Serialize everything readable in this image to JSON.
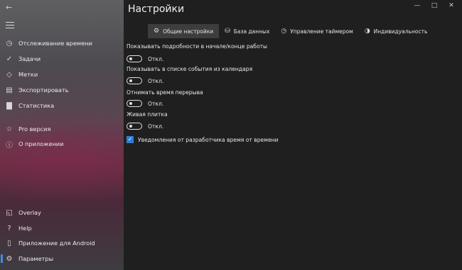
{
  "window": {
    "title": "Настройки"
  },
  "sidebar": {
    "items": [
      {
        "icon": "clock-icon",
        "label": "Отслеживание времени"
      },
      {
        "icon": "check-icon",
        "label": "Задачи"
      },
      {
        "icon": "tag-icon",
        "label": "Метки"
      },
      {
        "icon": "export-icon",
        "label": "Экспортировать"
      },
      {
        "icon": "chart-icon",
        "label": "Статистика"
      },
      {
        "icon": "star-icon",
        "label": "Pro версия"
      },
      {
        "icon": "info-icon",
        "label": "О приложении"
      },
      {
        "icon": "overlay-icon",
        "label": "Overlay"
      },
      {
        "icon": "help-icon",
        "label": "Help"
      },
      {
        "icon": "phone-icon",
        "label": "Приложение для Android"
      },
      {
        "icon": "gear-icon",
        "label": "Параметры"
      }
    ]
  },
  "tabs": [
    {
      "icon": "gear-icon",
      "label": "Общие настройки",
      "selected": true
    },
    {
      "icon": "database-icon",
      "label": "База данных",
      "selected": false
    },
    {
      "icon": "timer-icon",
      "label": "Управление таймером",
      "selected": false
    },
    {
      "icon": "palette-icon",
      "label": "Индивидуальность",
      "selected": false
    }
  ],
  "settings": [
    {
      "label": "Показывать подробности в начале/конце работы",
      "state": "Откл."
    },
    {
      "label": "Показывать в списке события из календаря",
      "state": "Откл."
    },
    {
      "label": "Отнимать время перерыва",
      "state": "Откл."
    },
    {
      "label": "Живая плитка",
      "state": "Откл."
    }
  ],
  "notifications": {
    "label": "Уведомления от разработчика время от времени",
    "checked": true
  },
  "colors": {
    "accent": "#2f7fd6",
    "background": "#1f1f1f",
    "tab_selected": "#3d3d3d"
  }
}
